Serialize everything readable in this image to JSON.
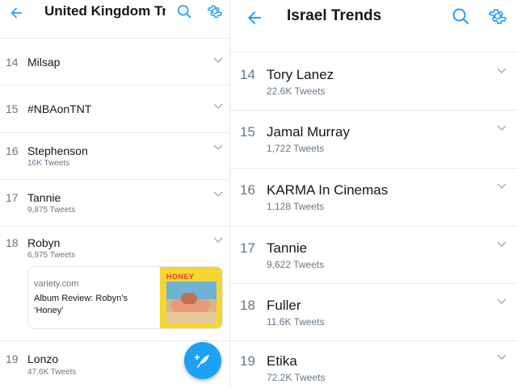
{
  "theme": {
    "accent": "#1da1f2",
    "text": "#14171a",
    "secondary": "#657786",
    "divider": "#e6ecf0"
  },
  "left": {
    "title": "United Kingdom Tr...",
    "icons": {
      "back": "back-arrow-icon",
      "search": "search-icon",
      "settings": "gear-icon"
    },
    "trends": [
      {
        "rank": "14",
        "name": "Milsap",
        "count": ""
      },
      {
        "rank": "15",
        "name": "#NBAonTNT",
        "count": ""
      },
      {
        "rank": "16",
        "name": "Stephenson",
        "count": "16K Tweets"
      },
      {
        "rank": "17",
        "name": "Tannie",
        "count": "9,875 Tweets"
      },
      {
        "rank": "18",
        "name": "Robyn",
        "count": "6,975 Tweets"
      },
      {
        "rank": "19",
        "name": "Lonzo",
        "count": "47.6K Tweets"
      }
    ],
    "card": {
      "domain": "variety.com",
      "headline": "Album Review: Robyn’s ‘Honey’",
      "thumb_text": "HONEY"
    },
    "fab": {
      "icon": "compose-tweet-icon"
    }
  },
  "right": {
    "title": "Israel Trends",
    "icons": {
      "back": "back-arrow-icon",
      "search": "search-icon",
      "settings": "gear-icon"
    },
    "trends": [
      {
        "rank": "14",
        "name": "Tory Lanez",
        "count": "22.6K Tweets"
      },
      {
        "rank": "15",
        "name": "Jamal Murray",
        "count": "1,722 Tweets"
      },
      {
        "rank": "16",
        "name": "KARMA In Cinemas",
        "count": "1,128 Tweets"
      },
      {
        "rank": "17",
        "name": "Tannie",
        "count": "9,622 Tweets"
      },
      {
        "rank": "18",
        "name": "Fuller",
        "count": "11.6K Tweets"
      },
      {
        "rank": "19",
        "name": "Etika",
        "count": "72.2K Tweets"
      }
    ]
  }
}
